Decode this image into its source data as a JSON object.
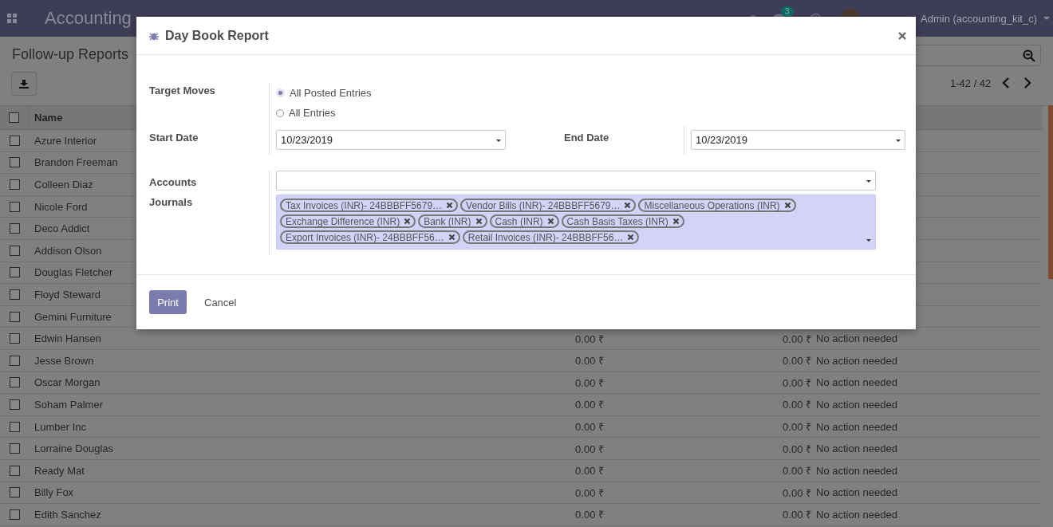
{
  "navbar": {
    "app_name": "Accounting",
    "message_count": "3",
    "user": "Admin (accounting_kit_c)"
  },
  "control_panel": {
    "title": "Follow-up Reports",
    "pager": "1-42 / 42"
  },
  "table": {
    "columns": [
      "Name"
    ],
    "all_checked": false,
    "rows": [
      {
        "name": "Azure Interior",
        "checked": false
      },
      {
        "name": "Brandon Freeman",
        "checked": false
      },
      {
        "name": "Colleen Diaz",
        "checked": false
      },
      {
        "name": "Nicole Ford",
        "checked": false
      },
      {
        "name": "Deco Addict",
        "checked": false
      },
      {
        "name": "Addison Olson",
        "checked": false
      },
      {
        "name": "Douglas Fletcher",
        "checked": false
      },
      {
        "name": "Floyd Steward",
        "checked": false
      },
      {
        "name": "Gemini Furniture",
        "checked": false
      },
      {
        "name": "Edwin Hansen",
        "checked": false,
        "column_2": "0.00 ₹",
        "column_3": "0.00 ₹",
        "column_4": "No action needed"
      },
      {
        "name": "Jesse Brown",
        "checked": false,
        "column_2": "0.00 ₹",
        "column_3": "0.00 ₹",
        "column_4": "No action needed"
      },
      {
        "name": "Oscar Morgan",
        "checked": false,
        "column_2": "0.00 ₹",
        "column_3": "0.00 ₹",
        "column_4": "No action needed"
      },
      {
        "name": "Soham Palmer",
        "checked": false,
        "column_2": "0.00 ₹",
        "column_3": "0.00 ₹",
        "column_4": "No action needed"
      },
      {
        "name": "Lumber Inc",
        "checked": false,
        "column_2": "0.00 ₹",
        "column_3": "0.00 ₹",
        "column_4": "No action needed"
      },
      {
        "name": "Lorraine Douglas",
        "checked": false,
        "column_2": "0.00 ₹",
        "column_3": "0.00 ₹",
        "column_4": "No action needed"
      },
      {
        "name": "Ready Mat",
        "checked": false,
        "column_2": "0.00 ₹",
        "column_3": "0.00 ₹",
        "column_4": "No action needed"
      },
      {
        "name": "Billy Fox",
        "checked": false,
        "column_2": "0.00 ₹",
        "column_3": "0.00 ₹",
        "column_4": "No action needed"
      },
      {
        "name": "Edith Sanchez",
        "checked": false,
        "column_2": "0.00 ₹",
        "column_3": "0.00 ₹",
        "column_4": "No action needed"
      }
    ]
  },
  "dialog": {
    "title": "Day Book Report",
    "target_moves": {
      "label": "Target Moves",
      "options": [
        {
          "label": "All Posted Entries",
          "selected": true
        },
        {
          "label": "All Entries",
          "selected": false
        }
      ]
    },
    "start_date": {
      "label": "Start Date",
      "value": "10/23/2019"
    },
    "end_date": {
      "label": "End Date",
      "value": "10/23/2019"
    },
    "accounts": {
      "label": "Accounts"
    },
    "journals": {
      "label": "Journals",
      "tags": [
        [
          "Tax Invoices (INR)- 24BBBFF5679…",
          "Vendor Bills (INR)- 24BBBFF5679…",
          "Miscellaneous Operations (INR)"
        ],
        [
          "Exchange Difference (INR)",
          "Bank (INR)",
          "Cash (INR)",
          "Cash Basis Taxes (INR)"
        ],
        [
          "Export Invoices (INR)- 24BBBFF56…",
          "Retail Invoices (INR)- 24BBBFF56…"
        ]
      ]
    },
    "buttons": [
      {
        "label": "Print",
        "kind": "primary"
      },
      {
        "label": "Cancel",
        "kind": "link"
      }
    ]
  }
}
